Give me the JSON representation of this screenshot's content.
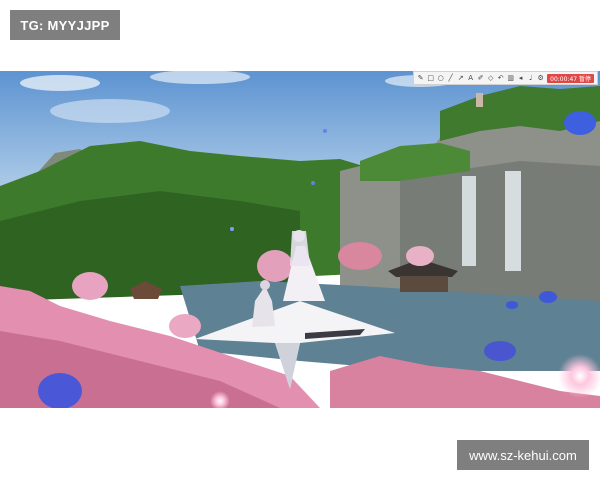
{
  "watermark_top": "TG: MYYJJPP",
  "watermark_bottom": "www.sz-kehui.com",
  "recording_toolbar": {
    "icons": [
      "pen-icon",
      "rectangle-icon",
      "circle-icon",
      "line-icon",
      "arrow-icon",
      "text-icon",
      "marker-icon",
      "eraser-icon",
      "undo-icon",
      "trash-icon",
      "speaker-icon",
      "mic-icon"
    ],
    "record_label": "00:00:47 暂停"
  },
  "colors": {
    "sky": "#7fb2e0",
    "foliage": "#3f7a2f",
    "blossom": "#e79ab8",
    "cliff": "#8c8f86",
    "water": "#6a8aa0"
  }
}
